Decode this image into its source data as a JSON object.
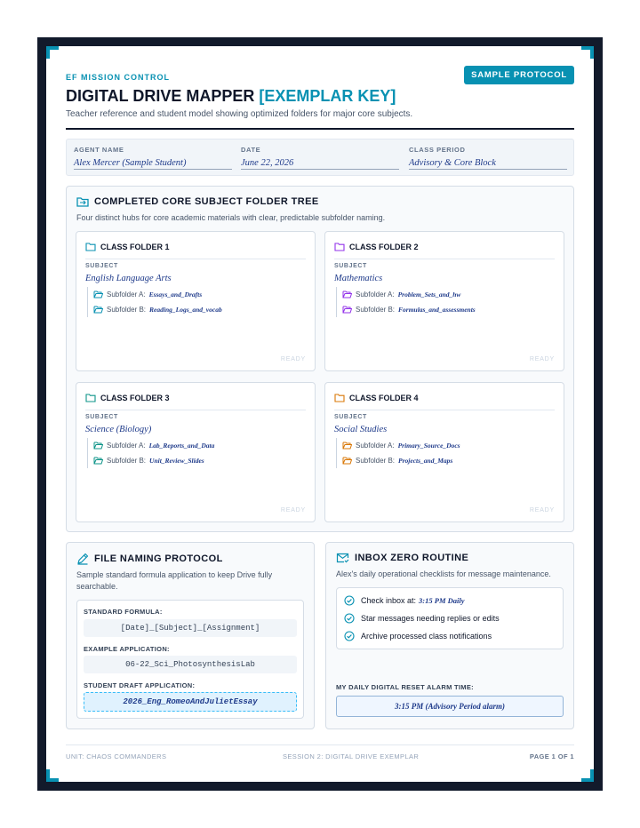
{
  "header": {
    "eyebrow": "EF MISSION CONTROL",
    "badge": "SAMPLE PROTOCOL",
    "title_main": "DIGITAL DRIVE MAPPER",
    "title_accent": "[EXEMPLAR KEY]",
    "subtitle": "Teacher reference and student model showing optimized folders for major core subjects."
  },
  "meta": {
    "agent_label": "AGENT NAME",
    "agent_value": "Alex Mercer (Sample Student)",
    "date_label": "DATE",
    "date_value": "June 22, 2026",
    "period_label": "CLASS PERIOD",
    "period_value": "Advisory & Core Block"
  },
  "tree": {
    "title": "COMPLETED CORE SUBJECT FOLDER TREE",
    "description": "Four distinct hubs for core academic materials with clear, predictable subfolder naming.",
    "folders": [
      {
        "heading": "CLASS FOLDER 1",
        "subject_label": "SUBJECT",
        "subject": "English Language Arts",
        "sub_a_label": "Subfolder A:",
        "sub_a": "Essays_and_Drafts",
        "sub_b_label": "Subfolder B:",
        "sub_b": "Reading_Logs_and_vocab",
        "status": "READY",
        "color": "#0891b2"
      },
      {
        "heading": "CLASS FOLDER 2",
        "subject_label": "SUBJECT",
        "subject": "Mathematics",
        "sub_a_label": "Subfolder A:",
        "sub_a": "Problem_Sets_and_hw",
        "sub_b_label": "Subfolder B:",
        "sub_b": "Formulas_and_assessments",
        "status": "READY",
        "color": "#9333ea"
      },
      {
        "heading": "CLASS FOLDER 3",
        "subject_label": "SUBJECT",
        "subject": "Science (Biology)",
        "sub_a_label": "Subfolder A:",
        "sub_a": "Lab_Reports_and_Data",
        "sub_b_label": "Subfolder B:",
        "sub_b": "Unit_Review_Slides",
        "status": "READY",
        "color": "#0d9488"
      },
      {
        "heading": "CLASS FOLDER 4",
        "subject_label": "SUBJECT",
        "subject": "Social Studies",
        "sub_a_label": "Subfolder A:",
        "sub_a": "Primary_Source_Docs",
        "sub_b_label": "Subfolder B:",
        "sub_b": "Projects_and_Maps",
        "status": "READY",
        "color": "#d97706"
      }
    ]
  },
  "naming": {
    "title": "FILE NAMING PROTOCOL",
    "description": "Sample standard formula application to keep Drive fully searchable.",
    "formula_label": "STANDARD FORMULA:",
    "formula": "[Date]_[Subject]_[Assignment]",
    "example_label": "EXAMPLE APPLICATION:",
    "example": "06-22_Sci_PhotosynthesisLab",
    "draft_label": "STUDENT DRAFT APPLICATION:",
    "draft": "2026_Eng_RomeoAndJulietEssay"
  },
  "inbox": {
    "title": "INBOX ZERO ROUTINE",
    "description": "Alex's daily operational checklists for message maintenance.",
    "item1_prefix": "Check inbox at:",
    "item1_time": "3:15 PM Daily",
    "item2": "Star messages needing replies or edits",
    "item3": "Archive processed class notifications",
    "alarm_label": "MY DAILY DIGITAL RESET ALARM TIME:",
    "alarm_value": "3:15 PM (Advisory Period alarm)"
  },
  "footer": {
    "left": "UNIT: CHAOS COMMANDERS",
    "center": "SESSION 2: DIGITAL DRIVE EXEMPLAR",
    "right": "PAGE 1 OF 1"
  },
  "colors": {
    "accent": "#0891b2",
    "frame": "#121a2b",
    "ink": "#1e3a8a"
  }
}
